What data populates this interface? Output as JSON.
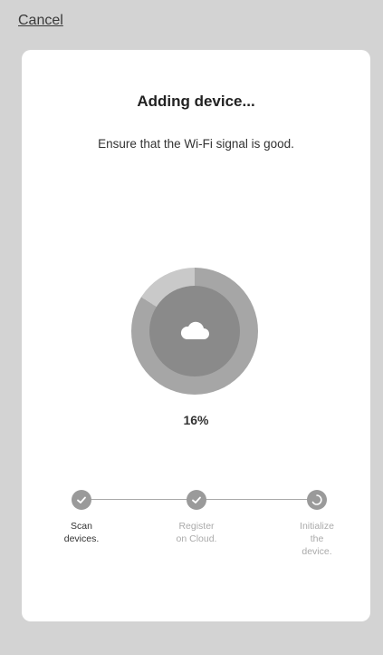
{
  "header": {
    "cancel_label": "Cancel"
  },
  "card": {
    "title": "Adding device...",
    "subtitle": "Ensure that the Wi-Fi signal is good."
  },
  "progress": {
    "value": 16,
    "label": "16%",
    "icon": "cloud-icon",
    "colors": {
      "ring_track": "#c9c9c9",
      "ring_fill": "#a6a6a6",
      "inner": "#8a8a8a"
    }
  },
  "steps": [
    {
      "line1": "Scan",
      "line2": "devices.",
      "line3": "",
      "status": "done",
      "icon": "check-icon"
    },
    {
      "line1": "Register",
      "line2": "on Cloud.",
      "line3": "",
      "status": "done",
      "icon": "check-icon"
    },
    {
      "line1": "Initialize",
      "line2": "the",
      "line3": "device.",
      "status": "in-progress",
      "icon": "loading-icon"
    }
  ]
}
